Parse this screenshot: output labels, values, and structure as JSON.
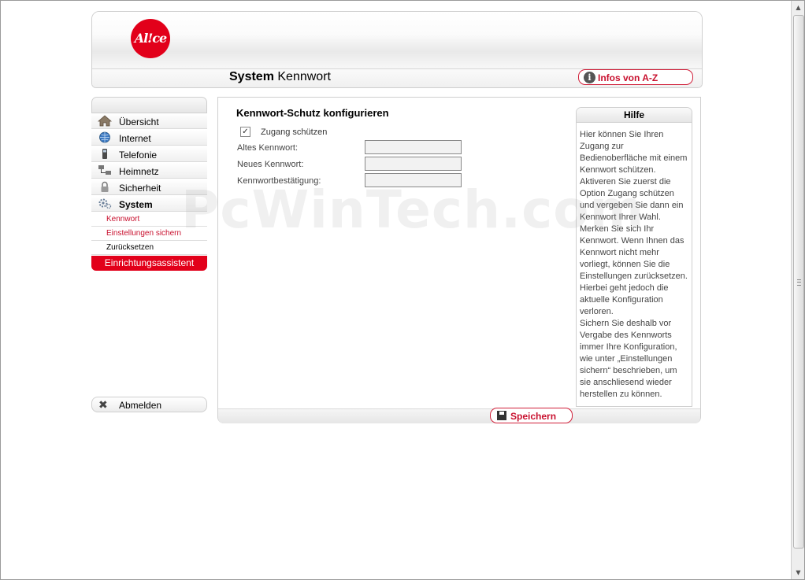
{
  "header": {
    "logo_text": "Al!ce",
    "title_bold": "System",
    "title_rest": "Kennwort",
    "infos_label": "Infos von A-Z"
  },
  "sidebar": {
    "items": [
      {
        "label": "Übersicht",
        "icon": "house-icon"
      },
      {
        "label": "Internet",
        "icon": "globe-icon"
      },
      {
        "label": "Telefonie",
        "icon": "phone-icon"
      },
      {
        "label": "Heimnetz",
        "icon": "network-icon"
      },
      {
        "label": "Sicherheit",
        "icon": "lock-icon"
      },
      {
        "label": "System",
        "icon": "gear-icon",
        "active": true
      }
    ],
    "subitems": [
      {
        "label": "Kennwort"
      },
      {
        "label": "Einstellungen sichern"
      },
      {
        "label": "Zurücksetzen"
      }
    ],
    "assistant_label": "Einrichtungsassistent",
    "logout_label": "Abmelden"
  },
  "main": {
    "section_title": "Kennwort-Schutz konfigurieren",
    "checkbox_label": "Zugang schützen",
    "checkbox_checked": true,
    "fields": [
      {
        "label": "Altes Kennwort:",
        "value": ""
      },
      {
        "label": "Neues Kennwort:",
        "value": ""
      },
      {
        "label": "Kennwortbestätigung:",
        "value": ""
      }
    ],
    "save_label": "Speichern"
  },
  "help": {
    "title": "Hilfe",
    "text": "Hier können Sie Ihren\nZugang zur\nBedienoberfläche mit einem\nKennwort schützen.\nAktiveren Sie zuerst die\nOption Zugang schützen\nund vergeben Sie dann ein\nKennwort Ihrer Wahl.\nMerken Sie sich Ihr\nKennwort. Wenn Ihnen das\nKennwort nicht mehr\nvorliegt, können Sie die\nEinstellungen zurücksetzen.\nHierbei geht jedoch die\naktuelle Konfiguration\nverloren.\nSichern Sie deshalb vor\nVergabe des Kennworts\nimmer Ihre Konfiguration,\nwie unter „Einstellungen\nsichern“ beschrieben, um\nsie anschliesend wieder\nherstellen zu können."
  },
  "watermark": "PcWinTech.com",
  "colors": {
    "brand_red": "#e2001a",
    "link_red": "#c8102e"
  }
}
